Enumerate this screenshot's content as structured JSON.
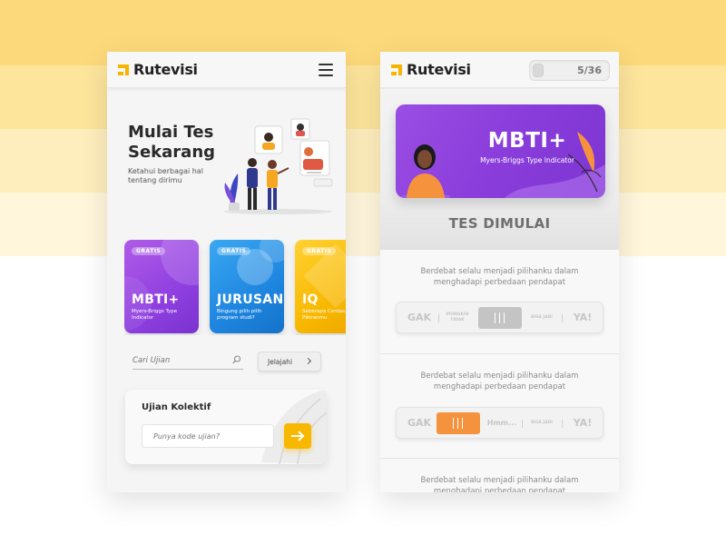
{
  "colors": {
    "background_bands": [
      "#fcd97a",
      "#fde59c",
      "#feeebd",
      "#fff6dc"
    ],
    "brand_yellow": "#f8b800",
    "purple": "#8f3fe0",
    "blue": "#1f86e0",
    "orange": "#f5923e"
  },
  "left_screen": {
    "brand": "Rutevisi",
    "menu_icon": "hamburger-menu-icon",
    "hero": {
      "title": "Mulai Tes Sekarang",
      "subtitle": "Ketahui berbagai hal tentang dirimu"
    },
    "cards": [
      {
        "badge": "GRATIS",
        "title": "MBTI+",
        "subtitle": "Myers-Briggs Type Indicator",
        "color": "#8f3fe0"
      },
      {
        "badge": "GRATIS",
        "title": "JURUSAN",
        "subtitle": "Bingung pilih pilih program studi?",
        "color": "#1f86e0"
      },
      {
        "badge": "GRATIS",
        "title": "IQ",
        "subtitle": "Seberapa Cerdas Sih Pikiranmu",
        "color": "#f8b800"
      }
    ],
    "search": {
      "placeholder": "Cari Ujian",
      "icon": "search-icon"
    },
    "explore_button": "Jelajahi",
    "collective": {
      "title": "Ujian Kolektif",
      "placeholder": "Punya kode ujian?",
      "submit_icon": "arrow-right-icon"
    }
  },
  "right_screen": {
    "brand": "Rutevisi",
    "progress": {
      "label": "5/36",
      "current": 5,
      "total": 36
    },
    "banner": {
      "title": "MBTI+",
      "subtitle": "Myers-Briggs Type Indicator"
    },
    "status": "TES DIMULAI",
    "questions": [
      {
        "text": "Berdebat selalu menjadi pilihanku dalam menghadapi perbedaan pendapat",
        "options": [
          "GAK",
          "MUNGKIN TIDAK",
          "BISA JADI",
          "YA!"
        ],
        "selected": "neutral"
      },
      {
        "text": "Berdebat selalu menjadi pilihanku dalam menghadapi perbedaan pendapat",
        "options": [
          "GAK",
          "Hmm...",
          "BISA JADI",
          "YA!"
        ],
        "selected": "MUNGKIN TIDAK"
      },
      {
        "text": "Berdebat selalu menjadi pilihanku dalam menghadapi perbedaan pendapat"
      }
    ]
  }
}
